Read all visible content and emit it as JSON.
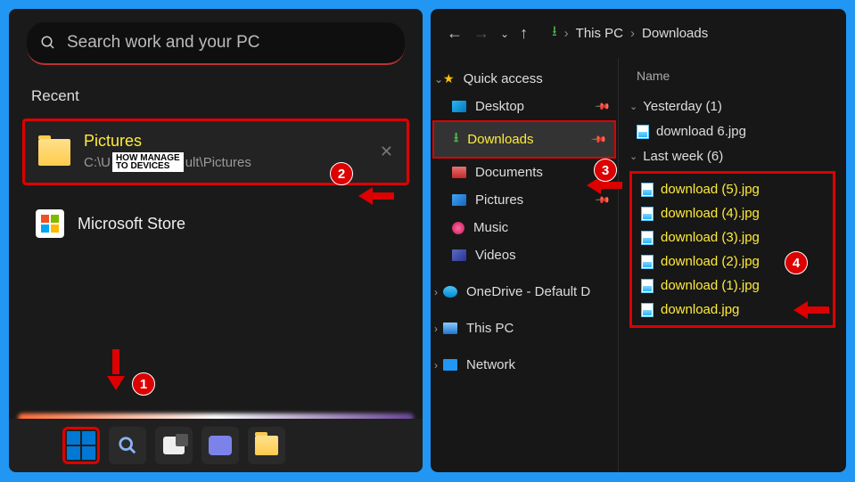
{
  "start": {
    "search_placeholder": "Search work and your PC",
    "recent_label": "Recent",
    "pictures": {
      "title": "Pictures",
      "path_suffix": "ult\\Pictures",
      "path_prefix": "C:\\U"
    },
    "watermark": {
      "l1": "HOW",
      "l2": "TO",
      "r1": "MANAGE",
      "r2": "DEVICES"
    },
    "store_label": "Microsoft Store"
  },
  "explorer": {
    "breadcrumb": [
      "This PC",
      "Downloads"
    ],
    "col_name": "Name",
    "nav": {
      "quick": "Quick access",
      "desktop": "Desktop",
      "downloads": "Downloads",
      "documents": "Documents",
      "pictures": "Pictures",
      "music": "Music",
      "videos": "Videos",
      "onedrive": "OneDrive - Default D",
      "thispc": "This PC",
      "network": "Network"
    },
    "groups": [
      {
        "label": "Yesterday (1)",
        "files": [
          "download 6.jpg"
        ],
        "highlight": false
      },
      {
        "label": "Last week (6)",
        "files": [
          "download (5).jpg",
          "download (4).jpg",
          "download (3).jpg",
          "download (2).jpg",
          "download (1).jpg",
          "download.jpg"
        ],
        "highlight": true
      }
    ]
  },
  "annotations": {
    "b1": "1",
    "b2": "2",
    "b3": "3",
    "b4": "4"
  }
}
